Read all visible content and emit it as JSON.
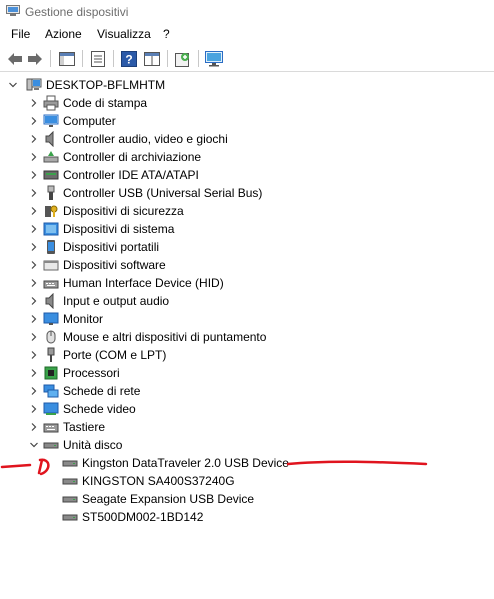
{
  "window": {
    "title": "Gestione dispositivi"
  },
  "menu": [
    "File",
    "Azione",
    "Visualizza",
    "?"
  ],
  "tree": {
    "root": "DESKTOP-BFLMHTM",
    "categories": [
      "Code di stampa",
      "Computer",
      "Controller audio, video e giochi",
      "Controller di archiviazione",
      "Controller IDE ATA/ATAPI",
      "Controller USB (Universal Serial Bus)",
      "Dispositivi di sicurezza",
      "Dispositivi di sistema",
      "Dispositivi portatili",
      "Dispositivi software",
      "Human Interface Device (HID)",
      "Input e output audio",
      "Monitor",
      "Mouse e altri dispositivi di puntamento",
      "Porte (COM e LPT)",
      "Processori",
      "Schede di rete",
      "Schede video",
      "Tastiere",
      "Unità disco"
    ],
    "disks": [
      "Kingston DataTraveler 2.0 USB Device",
      "KINGSTON SA400S37240G",
      "Seagate Expansion USB Device",
      "ST500DM002-1BD142"
    ]
  },
  "colors": {
    "annotation": "#e0141e",
    "accent": "#2b6cc4"
  }
}
